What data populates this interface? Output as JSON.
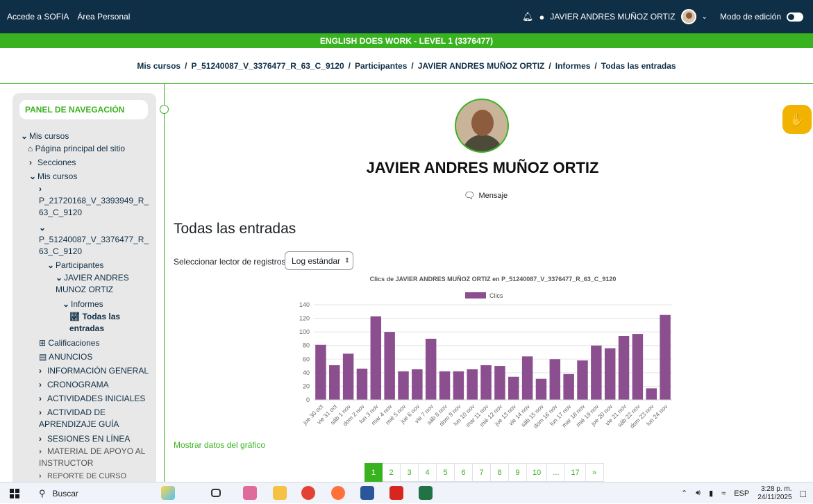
{
  "topbar": {
    "link1": "Accede a SOFIA",
    "link2": "Área Personal",
    "user_name": "JAVIER ANDRES MUÑOZ ORTIZ",
    "edit_mode": "Modo de edición"
  },
  "course_banner": "ENGLISH DOES WORK - LEVEL 1 (3376477)",
  "breadcrumb": [
    "Mis cursos",
    "P_51240087_V_3376477_R_63_C_9120",
    "Participantes",
    "JAVIER ANDRES MUÑOZ ORTIZ",
    "Informes",
    "Todas las entradas"
  ],
  "sidebar": {
    "title": "PANEL DE NAVEGACIÓN",
    "items": [
      {
        "chev": "⌄",
        "label": "Mis cursos"
      },
      {
        "chev": "",
        "label": "Página principal del sitio"
      },
      {
        "chev": "›",
        "label": "Secciones"
      },
      {
        "chev": "⌄",
        "label": "Mis cursos"
      },
      {
        "chev": "›",
        "label": "P_21720168_V_3393949_R_63_C_9120"
      },
      {
        "chev": "⌄",
        "label": "P_51240087_V_3376477_R_63_C_9120"
      },
      {
        "chev": "⌄",
        "label": "Participantes"
      },
      {
        "chev": "⌄",
        "label": "JAVIER ANDRES MUNOZ ORTIZ"
      },
      {
        "chev": "⌄",
        "label": "Informes"
      },
      {
        "chev": "",
        "label": "Todas las entradas"
      },
      {
        "chev": "",
        "label": "Calificaciones"
      },
      {
        "chev": "",
        "label": "ANUNCIOS"
      },
      {
        "chev": "›",
        "label": "INFORMACIÓN GENERAL"
      },
      {
        "chev": "›",
        "label": "CRONOGRAMA"
      },
      {
        "chev": "›",
        "label": "ACTIVIDADES INICIALES"
      },
      {
        "chev": "›",
        "label": "ACTIVIDAD DE APRENDIZAJE GUÍA"
      },
      {
        "chev": "›",
        "label": "SESIONES EN LÍNEA"
      },
      {
        "chev": "›",
        "label": "MATERIAL DE APOYO AL INSTRUCTOR"
      },
      {
        "chev": "›",
        "label": "REPORTE DE CURSO"
      }
    ]
  },
  "profile": {
    "name": "JAVIER ANDRES MUÑOZ ORTIZ",
    "message_label": "Mensaje"
  },
  "page_title": "Todas las entradas",
  "selector": {
    "label": "Seleccionar lector de registros",
    "value": "Log estándar"
  },
  "chart_data": {
    "type": "bar",
    "title": "Clics de JAVIER ANDRES MUÑOZ ORTIZ  en P_51240087_V_3376477_R_63_C_9120",
    "legend": "Clics",
    "color": "#8b4f8f",
    "categories": [
      "jue 30 oct",
      "vie 31 oct",
      "sáb 1 nov",
      "dom 2 nov",
      "lun 3 nov",
      "mar 4 nov",
      "mié 5 nov",
      "jue 6 nov",
      "vie 7 nov",
      "sáb 8 nov",
      "dom 9 nov",
      "lun 10 nov",
      "mar 11 nov",
      "mié 12 nov",
      "jue 13 nov",
      "vie 14 nov",
      "sáb 15 nov",
      "dom 16 nov",
      "lun 17 nov",
      "mar 18 nov",
      "mié 19 nov",
      "jue 20 nov",
      "vie 21 nov",
      "sáb 22 nov",
      "dom 23 nov",
      "lun 24 nov"
    ],
    "values": [
      81,
      51,
      68,
      46,
      123,
      100,
      42,
      45,
      90,
      42,
      42,
      45,
      51,
      50,
      34,
      64,
      31,
      60,
      38,
      58,
      80,
      76,
      94,
      97,
      17,
      125
    ],
    "ylim": [
      0,
      140
    ],
    "yticks": [
      0,
      20,
      40,
      60,
      80,
      100,
      120,
      140
    ]
  },
  "show_data_link": "Mostrar datos del gráfico",
  "pagination": [
    "1",
    "2",
    "3",
    "4",
    "5",
    "6",
    "7",
    "8",
    "9",
    "10",
    "...",
    "17",
    "»"
  ],
  "taskbar": {
    "search": "Buscar",
    "lang": "ESP",
    "time": "3:28 p. m.",
    "date": "24/11/2025"
  },
  "colors": {
    "navbar": "#0f2f46",
    "accent": "#39b220",
    "bars": "#8b4f8f"
  }
}
